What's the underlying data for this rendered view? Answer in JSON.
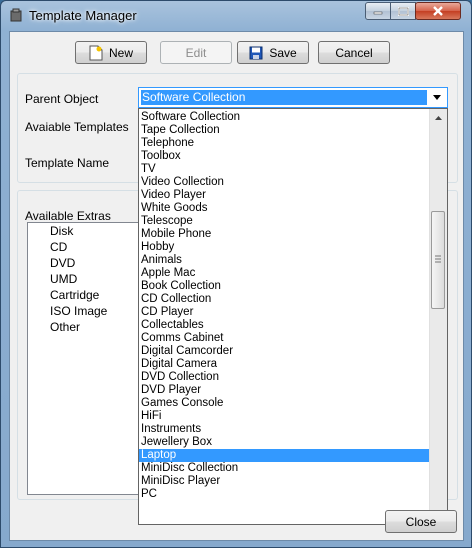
{
  "window": {
    "title": "Template Manager",
    "icon": "app-icon"
  },
  "toolbar": {
    "new_label": "New",
    "edit_label": "Edit",
    "save_label": "Save",
    "cancel_label": "Cancel"
  },
  "form": {
    "parent_object_label": "Parent Object",
    "available_templates_label": "Avaiable Templates",
    "template_name_label": "Template Name",
    "parent_object_value": "Software Collection",
    "available_extras_label": "Available Extras"
  },
  "dropdown": {
    "options": [
      "Software Collection",
      "Tape Collection",
      "Telephone",
      "Toolbox",
      "TV",
      "Video Collection",
      "Video Player",
      "White Goods",
      "Telescope",
      "Mobile Phone",
      "Hobby",
      "Animals",
      "Apple Mac",
      "Book Collection",
      "CD Collection",
      "CD Player",
      "Collectables",
      "Comms Cabinet",
      "Digital Camcorder",
      "Digital Camera",
      "DVD Collection",
      "DVD Player",
      "Games Console",
      "HiFi",
      "Instruments",
      "Jewellery Box",
      "Laptop",
      "MiniDisc Collection",
      "MiniDisc Player",
      "PC"
    ],
    "highlighted": "Laptop"
  },
  "extras": [
    "Disk",
    "CD",
    "DVD",
    "UMD",
    "Cartridge",
    "ISO Image",
    "Other"
  ],
  "footer": {
    "close_label": "Close"
  },
  "colors": {
    "selection": "#3399ff",
    "window_bg": "#f0f0f0"
  }
}
